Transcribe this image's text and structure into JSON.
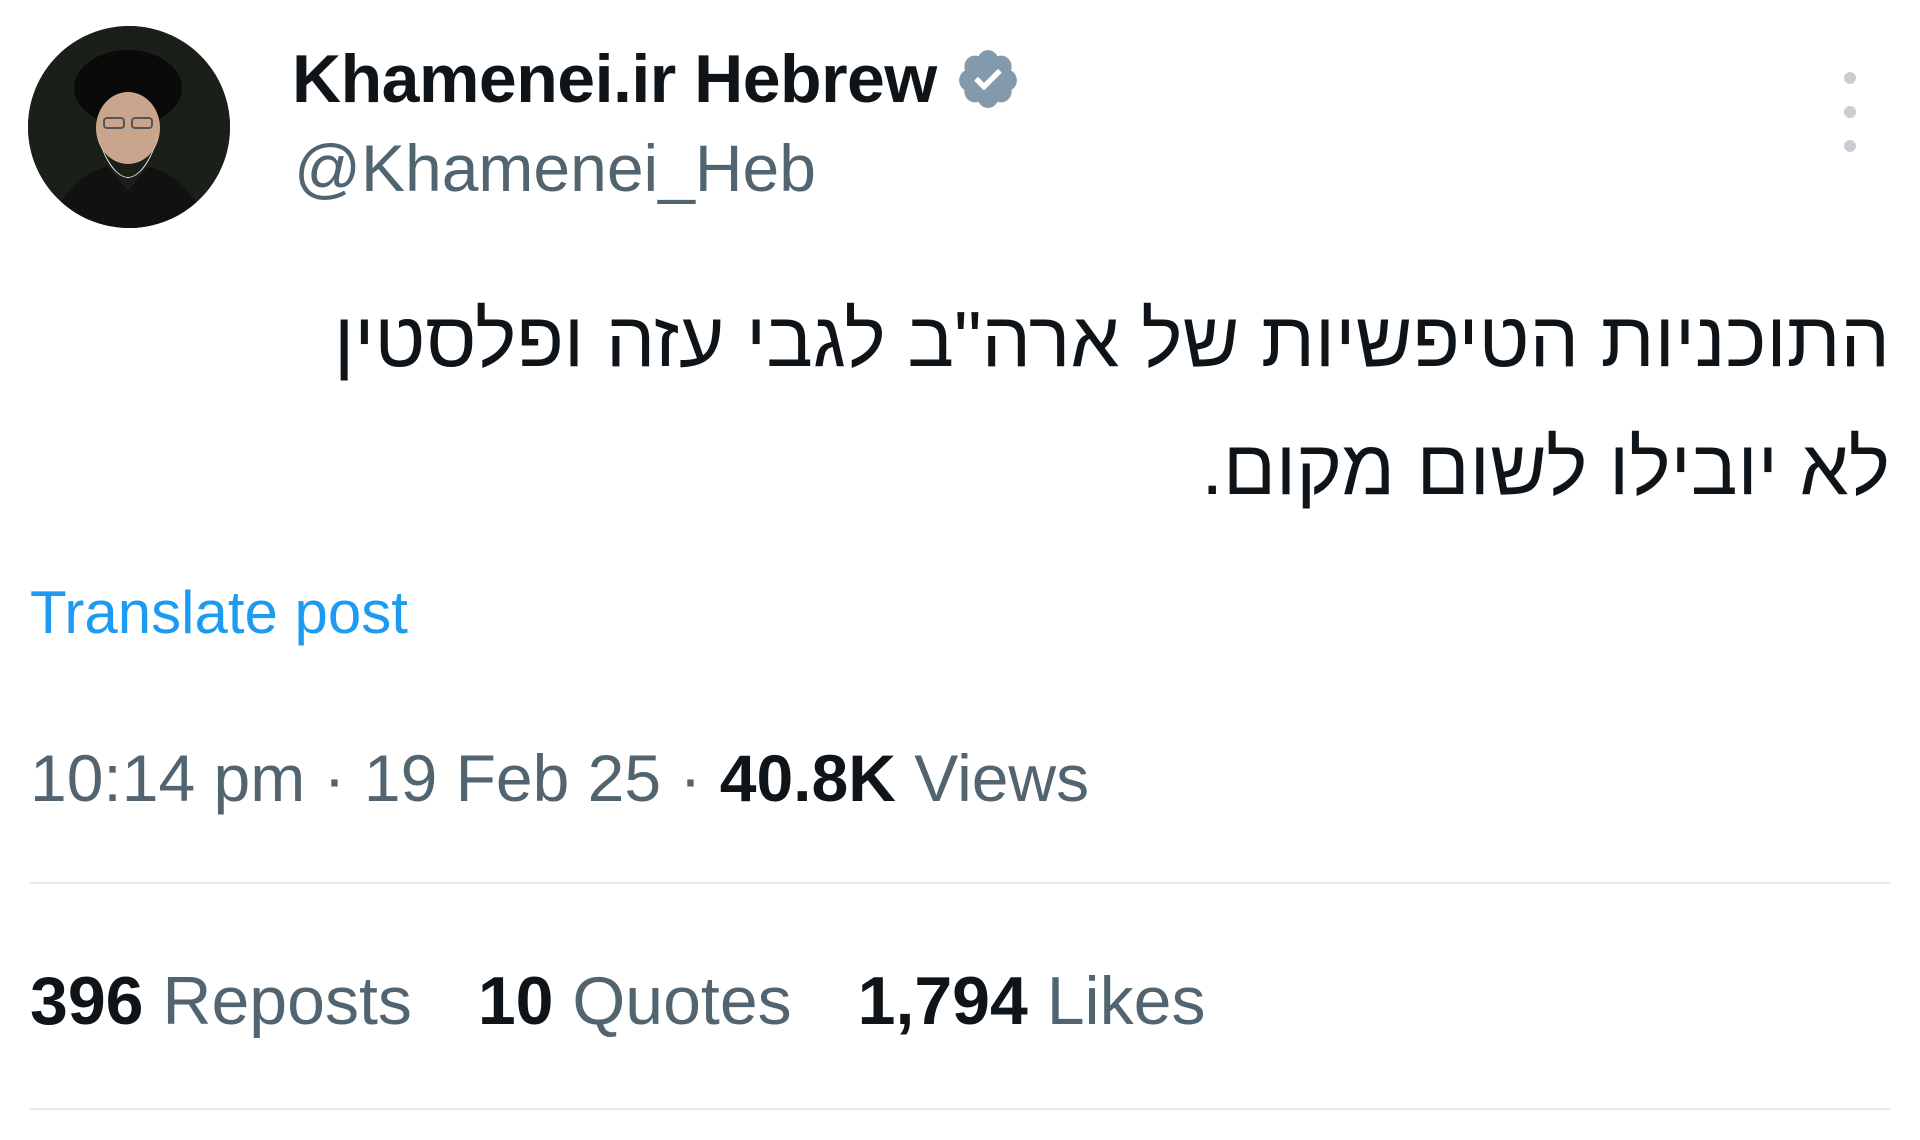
{
  "author": {
    "display_name": "Khamenei.ir Hebrew",
    "handle": "@Khamenei_Heb",
    "verified_icon": "verified-badge-icon",
    "badge_color": "#829aab"
  },
  "post": {
    "text_line_1": "התוכניות הטיפשיות של ארה\"ב לגבי עזה ופלסטין",
    "text_line_2": "לא יובילו לשום מקום.",
    "translate_label": "Translate post"
  },
  "meta": {
    "time": "10:14 pm",
    "separator": "·",
    "date": "19 Feb 25",
    "views_count": "40.8K",
    "views_label": "Views"
  },
  "stats": {
    "reposts_count": "396",
    "reposts_label": "Reposts",
    "quotes_count": "10",
    "quotes_label": "Quotes",
    "likes_count": "1,794",
    "likes_label": "Likes"
  },
  "colors": {
    "text_primary": "#0f1419",
    "text_secondary": "#536471",
    "link": "#1d9bf0",
    "divider": "#e7eaed"
  }
}
